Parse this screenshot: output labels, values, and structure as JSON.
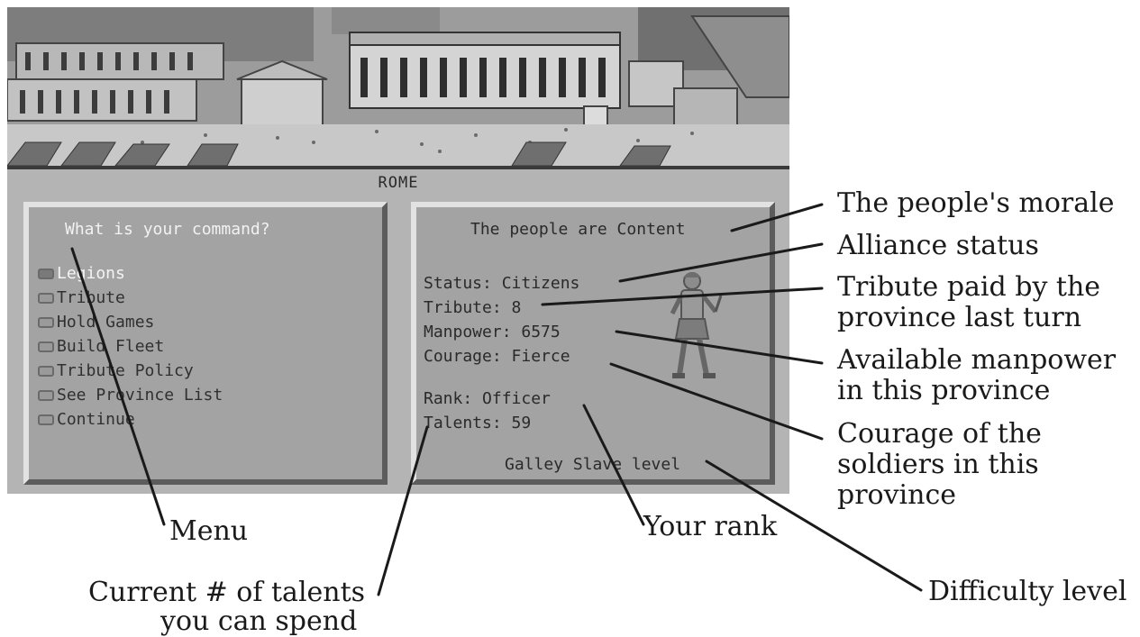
{
  "location_title": "ROME",
  "menu": {
    "prompt": "What is your command?",
    "items": [
      {
        "label": "Legions",
        "selected": true
      },
      {
        "label": "Tribute",
        "selected": false
      },
      {
        "label": "Hold Games",
        "selected": false
      },
      {
        "label": "Build Fleet",
        "selected": false
      },
      {
        "label": "Tribute Policy",
        "selected": false
      },
      {
        "label": "See Province List",
        "selected": false
      },
      {
        "label": "Continue",
        "selected": false
      }
    ]
  },
  "province": {
    "morale": "The people are Content",
    "status": "Status: Citizens",
    "tribute": "Tribute: 8",
    "manpower": "Manpower: 6575",
    "courage": "Courage: Fierce",
    "rank": "Rank: Officer",
    "talents": "Talents: 59",
    "difficulty": "Galley Slave level"
  },
  "callouts": {
    "morale": "The people's morale",
    "alliance": "Alliance status",
    "tribute_1": "Tribute paid by the",
    "tribute_2": "province last turn",
    "manpower_1": "Available manpower",
    "manpower_2": "in this province",
    "courage_1": "Courage of the",
    "courage_2": "soldiers in this",
    "courage_3": "province",
    "menu": "Menu",
    "rank": "Your rank",
    "difficulty": "Difficulty level",
    "talents_1": "Current # of talents",
    "talents_2": "you can spend"
  },
  "icons": {
    "soldier": "roman-soldier-icon"
  },
  "colors": {
    "screen_bg": "#b4b4b4",
    "panel_bg": "#a3a3a3",
    "selected_text": "#f4f4f4"
  }
}
